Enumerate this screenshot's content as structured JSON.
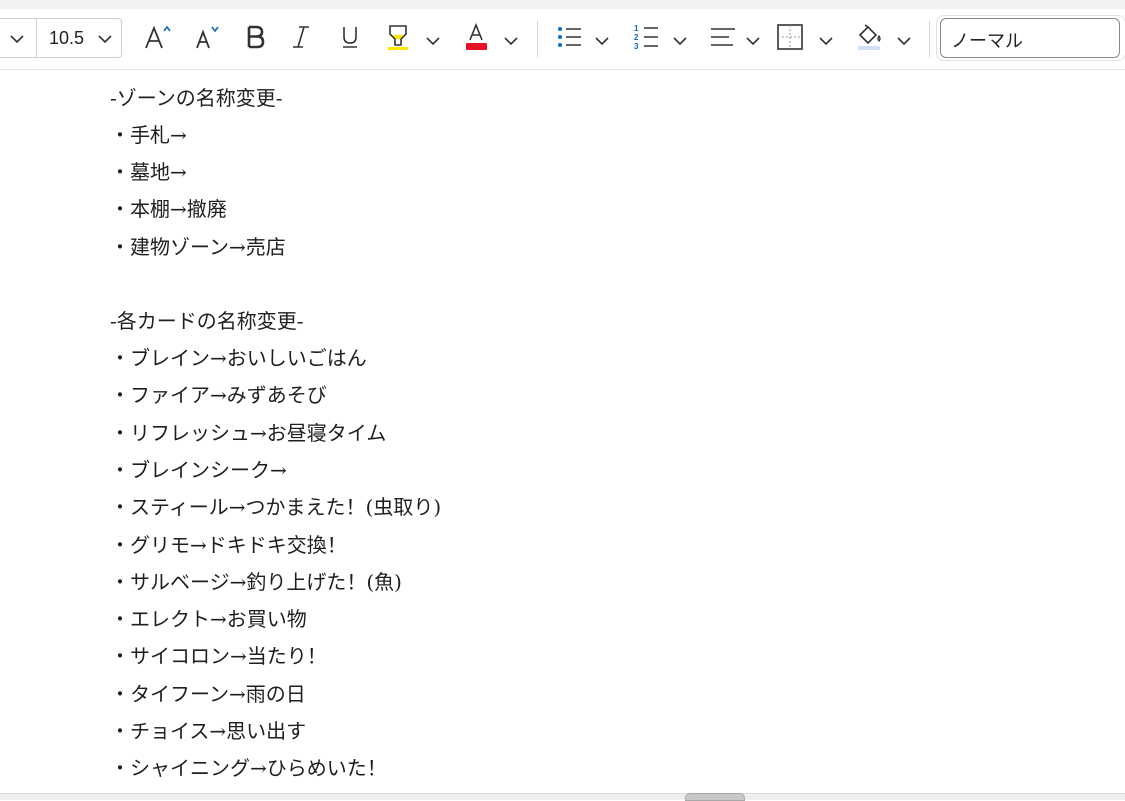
{
  "toolbar": {
    "font_size": "10.5",
    "style_value": "ノーマル",
    "icons": {
      "grow_font": "grow-font-icon",
      "shrink_font": "shrink-font-icon",
      "bold": "bold-icon",
      "italic": "italic-icon",
      "underline": "underline-icon",
      "highlight": "highlighter-icon",
      "font_color": "font-color-icon",
      "bullets": "bullet-list-icon",
      "numbering": "numbered-list-icon",
      "align": "align-icon",
      "borders": "borders-icon",
      "shading": "shading-icon"
    },
    "colors": {
      "font_color_bar": "#e81123",
      "highlight_bar": "#ffe600",
      "numbering_accent": "#0f6cbd"
    }
  },
  "document": {
    "lines": [
      "-ゾーンの名称変更-",
      "・手札→",
      "・墓地→",
      "・本棚→撤廃",
      "・建物ゾーン→売店",
      "",
      "-各カードの名称変更-",
      "・ブレイン→おいしいごはん",
      "・ファイア→みずあそび",
      "・リフレッシュ→お昼寝タイム",
      "・ブレインシーク→",
      "・スティール→つかまえた！(虫取り)",
      "・グリモ→ドキドキ交換！",
      "・サルベージ→釣り上げた！(魚)",
      "・エレクト→お買い物",
      "・サイコロン→当たり！",
      "・タイフーン→雨の日",
      "・チョイス→思い出す",
      "・シャイニング→ひらめいた！"
    ]
  }
}
